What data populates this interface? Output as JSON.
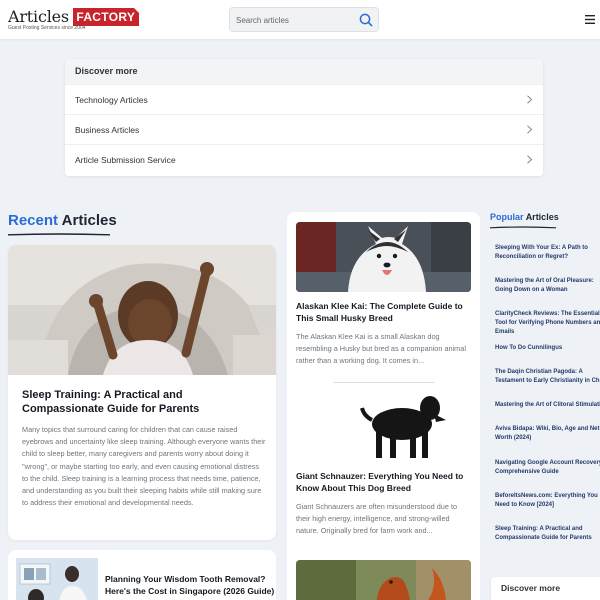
{
  "header": {
    "logo_word": "Articles",
    "logo_badge": "FACTORY",
    "logo_tagline": "Guest Posting Services since 2004",
    "search_placeholder": "Search articles"
  },
  "discover": {
    "title": "Discover more",
    "items": [
      {
        "label": "Technology Articles"
      },
      {
        "label": "Business Articles"
      },
      {
        "label": "Article Submission Service"
      }
    ]
  },
  "recent": {
    "title_accent": "Recent",
    "title_rest": "Articles",
    "featured": {
      "title": "Sleep Training: A Practical and Compassionate Guide for Parents",
      "excerpt": "Many topics that surround caring for children that can cause raised eyebrows and uncertainty like sleep training. Although everyone wants their child to sleep better, many caregivers and parents worry about doing it \"wrong\", or maybe starting too early, and even causing emotional distress to the child. Sleep training is a learning process that needs time, patience, and understanding as you built their sleeping habits while still making sure to address their emotional and developmental needs."
    },
    "secondary": {
      "title": "Planning Your Wisdom Tooth Removal? Here's the Cost in Singapore (2026 Guide)"
    }
  },
  "middle": {
    "articles": [
      {
        "title": "Alaskan Klee Kai: The Complete Guide to This Small Husky Breed",
        "excerpt": "The Alaskan Klee Kai is a small Alaskan dog resembling a Husky but bred as a companion animal rather than a working dog. It comes in..."
      },
      {
        "title": "Giant Schnauzer: Everything You Need to Know About This Dog Breed",
        "excerpt": "Giant Schnauzers are often misunderstood due to their high energy, intelligence, and strong-willed nature. Originally bred for farm work and..."
      }
    ]
  },
  "popular": {
    "title_accent": "Popular",
    "title_rest": "Articles",
    "items": [
      {
        "title": "Sleeping With Your Ex: A Path to Reconciliation or Regret?"
      },
      {
        "title": "Mastering the Art of Oral Pleasure: Going Down on a Woman"
      },
      {
        "title": "ClarityCheck Reviews: The Essential Tool for Verifying Phone Numbers and Emails"
      },
      {
        "title": "How To Do Cunnilingus"
      },
      {
        "title": "The Daqin Christian Pagoda: A Testament to Early Christianity in China"
      },
      {
        "title": "Mastering the Art of Clitoral Stimulation"
      },
      {
        "title": "Aviva Bidapa: Wiki, Bio, Age and Net Worth (2024)"
      },
      {
        "title": "Navigating Google Account Recovery: A Comprehensive Guide"
      },
      {
        "title": "BeforeItsNews.com: Everything You Need to Know [2024]"
      },
      {
        "title": "Sleep Training: A Practical and Compassionate Guide for Parents"
      }
    ],
    "discover_more": "Discover more"
  },
  "colors": {
    "accent": "#2b6cd4",
    "brand_red": "#c8242b",
    "background": "#eef2f6"
  }
}
